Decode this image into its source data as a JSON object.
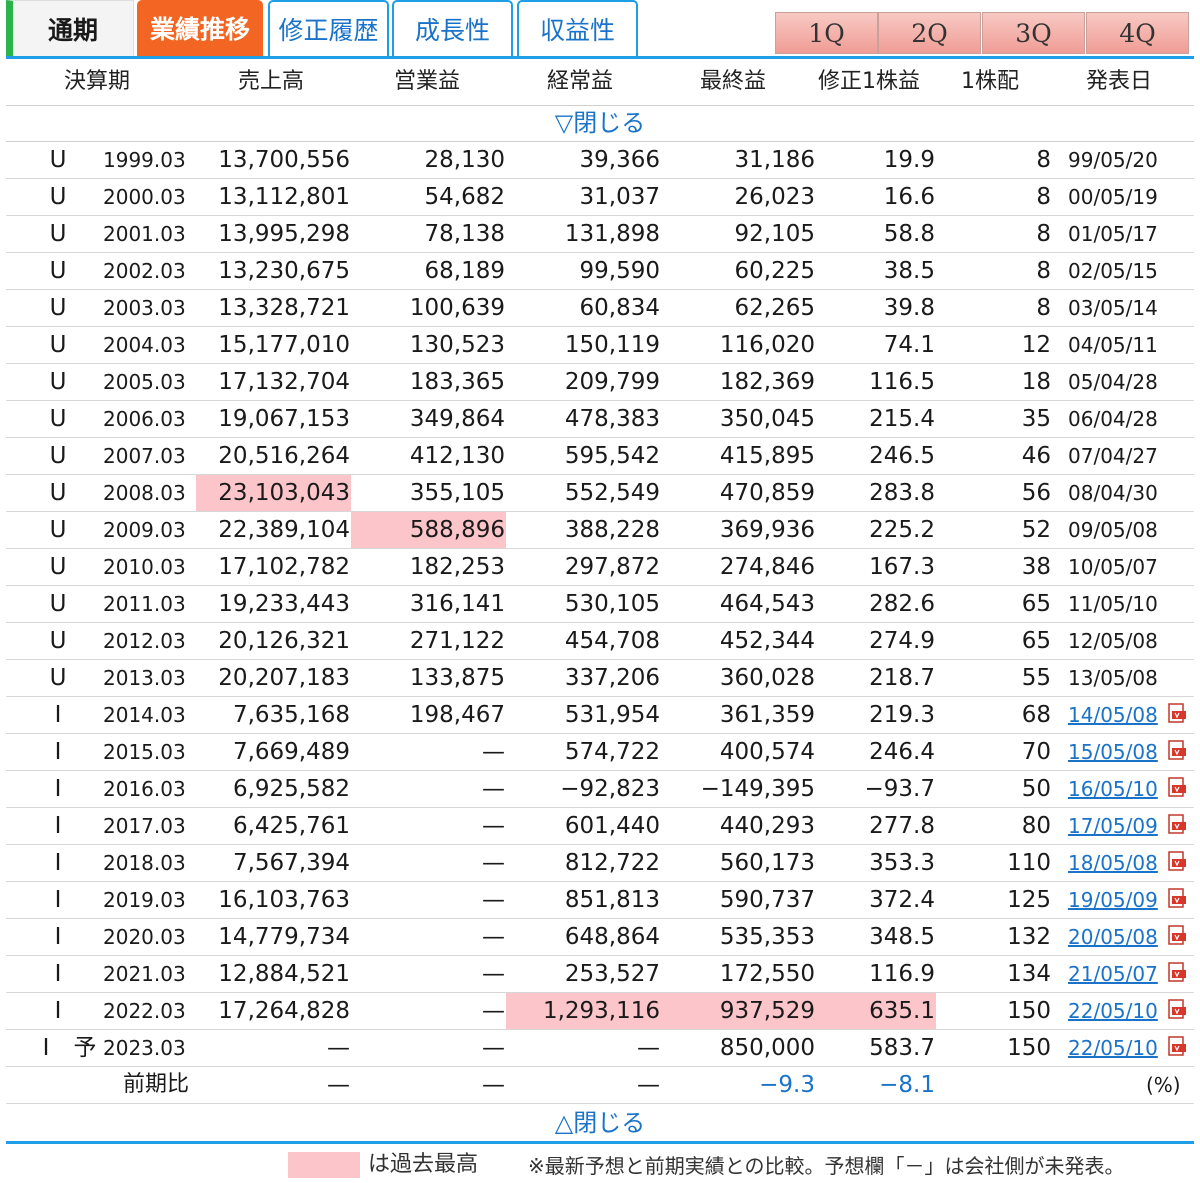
{
  "tabs": {
    "tsuki": "通期",
    "gyoseki": "業績推移",
    "shusei": "修正履歴",
    "seicho": "成長性",
    "shueki": "収益性"
  },
  "quarters": [
    "1Q",
    "2Q",
    "3Q",
    "4Q"
  ],
  "headers": {
    "period": "決算期",
    "sales": "売上高",
    "op": "営業益",
    "ord": "経常益",
    "net": "最終益",
    "eps": "修正1株益",
    "div": "1株配",
    "date": "発表日"
  },
  "toggle": {
    "close_top": "▽閉じる",
    "close_bottom": "△閉じる"
  },
  "rows": [
    {
      "type": "U",
      "period": "1999.03",
      "sales": "13,700,556",
      "op": "28,130",
      "ord": "39,366",
      "net": "31,186",
      "eps": "19.9",
      "div": "8",
      "date": "99/05/20"
    },
    {
      "type": "U",
      "period": "2000.03",
      "sales": "13,112,801",
      "op": "54,682",
      "ord": "31,037",
      "net": "26,023",
      "eps": "16.6",
      "div": "8",
      "date": "00/05/19"
    },
    {
      "type": "U",
      "period": "2001.03",
      "sales": "13,995,298",
      "op": "78,138",
      "ord": "131,898",
      "net": "92,105",
      "eps": "58.8",
      "div": "8",
      "date": "01/05/17"
    },
    {
      "type": "U",
      "period": "2002.03",
      "sales": "13,230,675",
      "op": "68,189",
      "ord": "99,590",
      "net": "60,225",
      "eps": "38.5",
      "div": "8",
      "date": "02/05/15"
    },
    {
      "type": "U",
      "period": "2003.03",
      "sales": "13,328,721",
      "op": "100,639",
      "ord": "60,834",
      "net": "62,265",
      "eps": "39.8",
      "div": "8",
      "date": "03/05/14"
    },
    {
      "type": "U",
      "period": "2004.03",
      "sales": "15,177,010",
      "op": "130,523",
      "ord": "150,119",
      "net": "116,020",
      "eps": "74.1",
      "div": "12",
      "date": "04/05/11"
    },
    {
      "type": "U",
      "period": "2005.03",
      "sales": "17,132,704",
      "op": "183,365",
      "ord": "209,799",
      "net": "182,369",
      "eps": "116.5",
      "div": "18",
      "date": "05/04/28"
    },
    {
      "type": "U",
      "period": "2006.03",
      "sales": "19,067,153",
      "op": "349,864",
      "ord": "478,383",
      "net": "350,045",
      "eps": "215.4",
      "div": "35",
      "date": "06/04/28"
    },
    {
      "type": "U",
      "period": "2007.03",
      "sales": "20,516,264",
      "op": "412,130",
      "ord": "595,542",
      "net": "415,895",
      "eps": "246.5",
      "div": "46",
      "date": "07/04/27"
    },
    {
      "type": "U",
      "period": "2008.03",
      "sales": "23,103,043",
      "op": "355,105",
      "ord": "552,549",
      "net": "470,859",
      "eps": "283.8",
      "div": "56",
      "date": "08/04/30"
    },
    {
      "type": "U",
      "period": "2009.03",
      "sales": "22,389,104",
      "op": "588,896",
      "ord": "388,228",
      "net": "369,936",
      "eps": "225.2",
      "div": "52",
      "date": "09/05/08"
    },
    {
      "type": "U",
      "period": "2010.03",
      "sales": "17,102,782",
      "op": "182,253",
      "ord": "297,872",
      "net": "274,846",
      "eps": "167.3",
      "div": "38",
      "date": "10/05/07"
    },
    {
      "type": "U",
      "period": "2011.03",
      "sales": "19,233,443",
      "op": "316,141",
      "ord": "530,105",
      "net": "464,543",
      "eps": "282.6",
      "div": "65",
      "date": "11/05/10"
    },
    {
      "type": "U",
      "period": "2012.03",
      "sales": "20,126,321",
      "op": "271,122",
      "ord": "454,708",
      "net": "452,344",
      "eps": "274.9",
      "div": "65",
      "date": "12/05/08"
    },
    {
      "type": "U",
      "period": "2013.03",
      "sales": "20,207,183",
      "op": "133,875",
      "ord": "337,206",
      "net": "360,028",
      "eps": "218.7",
      "div": "55",
      "date": "13/05/08"
    },
    {
      "type": "I",
      "period": "2014.03",
      "sales": "7,635,168",
      "op": "198,467",
      "ord": "531,954",
      "net": "361,359",
      "eps": "219.3",
      "div": "68",
      "date": "14/05/08"
    },
    {
      "type": "I",
      "period": "2015.03",
      "sales": "7,669,489",
      "op": "—",
      "ord": "574,722",
      "net": "400,574",
      "eps": "246.4",
      "div": "70",
      "date": "15/05/08"
    },
    {
      "type": "I",
      "period": "2016.03",
      "sales": "6,925,582",
      "op": "—",
      "ord": "−92,823",
      "net": "−149,395",
      "eps": "−93.7",
      "div": "50",
      "date": "16/05/10"
    },
    {
      "type": "I",
      "period": "2017.03",
      "sales": "6,425,761",
      "op": "—",
      "ord": "601,440",
      "net": "440,293",
      "eps": "277.8",
      "div": "80",
      "date": "17/05/09"
    },
    {
      "type": "I",
      "period": "2018.03",
      "sales": "7,567,394",
      "op": "—",
      "ord": "812,722",
      "net": "560,173",
      "eps": "353.3",
      "div": "110",
      "date": "18/05/08"
    },
    {
      "type": "I",
      "period": "2019.03",
      "sales": "16,103,763",
      "op": "—",
      "ord": "851,813",
      "net": "590,737",
      "eps": "372.4",
      "div": "125",
      "date": "19/05/09"
    },
    {
      "type": "I",
      "period": "2020.03",
      "sales": "14,779,734",
      "op": "—",
      "ord": "648,864",
      "net": "535,353",
      "eps": "348.5",
      "div": "132",
      "date": "20/05/08"
    },
    {
      "type": "I",
      "period": "2021.03",
      "sales": "12,884,521",
      "op": "—",
      "ord": "253,527",
      "net": "172,550",
      "eps": "116.9",
      "div": "134",
      "date": "21/05/07"
    },
    {
      "type": "I",
      "period": "2022.03",
      "sales": "17,264,828",
      "op": "—",
      "ord": "1,293,116",
      "net": "937,529",
      "eps": "635.1",
      "div": "150",
      "date": "22/05/10"
    },
    {
      "type": "I",
      "yo": "予",
      "period": "2023.03",
      "sales": "—",
      "op": "—",
      "ord": "—",
      "net": "850,000",
      "eps": "583.7",
      "div": "150",
      "date": "22/05/10"
    }
  ],
  "ratio_row": {
    "label": "前期比",
    "sales": "—",
    "op": "—",
    "ord": "—",
    "net": "−9.3",
    "eps": "−8.1",
    "unit": "(%)"
  },
  "legend": {
    "text": "は過去最高",
    "note": "※最新予想と前期実績との比較。予想欄「－」は会社側が未発表。"
  },
  "colors": {
    "highlight": "#fcc5c9",
    "accent_orange": "#f26522",
    "accent_blue": "#1e9ee6",
    "accent_green": "#29b34a",
    "link_blue": "#1a73c9"
  }
}
